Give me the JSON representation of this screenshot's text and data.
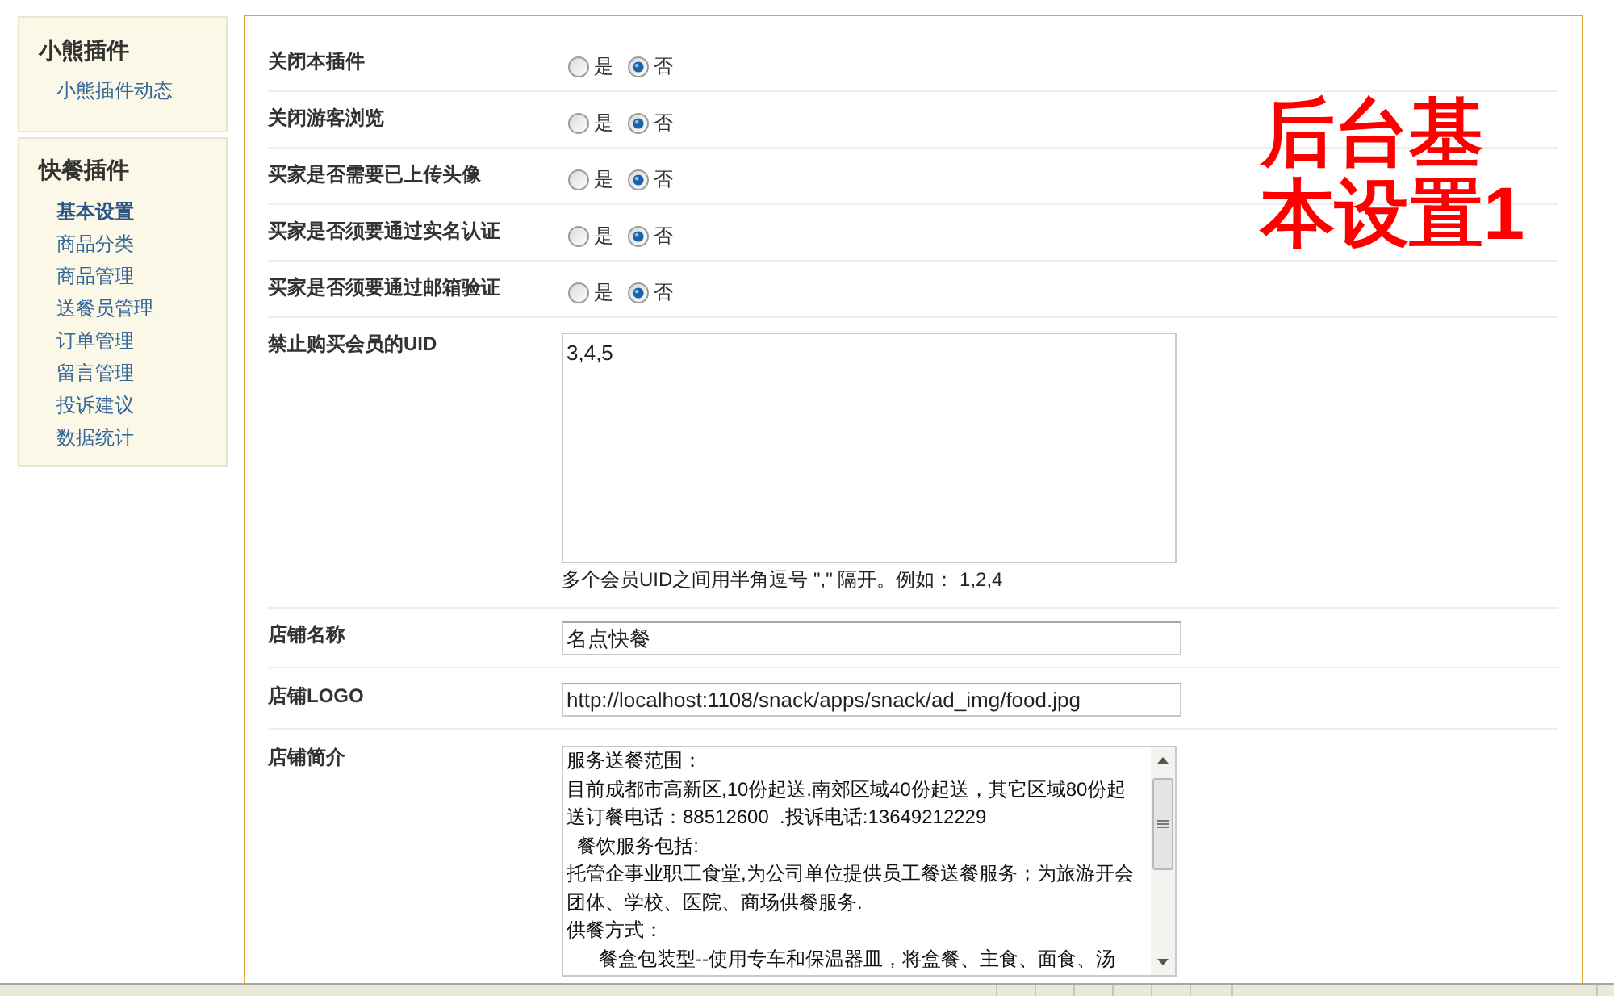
{
  "sidebar": {
    "groups": [
      {
        "title": "小熊插件",
        "items": [
          {
            "label": "小熊插件动态",
            "selected": false
          }
        ]
      },
      {
        "title": "快餐插件",
        "items": [
          {
            "label": "基本设置",
            "selected": true
          },
          {
            "label": "商品分类",
            "selected": false
          },
          {
            "label": "商品管理",
            "selected": false
          },
          {
            "label": "送餐员管理",
            "selected": false
          },
          {
            "label": "订单管理",
            "selected": false
          },
          {
            "label": "留言管理",
            "selected": false
          },
          {
            "label": "投诉建议",
            "selected": false
          },
          {
            "label": "数据统计",
            "selected": false
          }
        ]
      }
    ]
  },
  "form": {
    "rows": [
      {
        "kind": "radio",
        "label": "关闭本插件",
        "options": [
          {
            "label": "是",
            "selected": false
          },
          {
            "label": "否",
            "selected": true
          }
        ]
      },
      {
        "kind": "radio",
        "label": "关闭游客浏览",
        "options": [
          {
            "label": "是",
            "selected": false
          },
          {
            "label": "否",
            "selected": true
          }
        ]
      },
      {
        "kind": "radio",
        "label": "买家是否需要已上传头像",
        "options": [
          {
            "label": "是",
            "selected": false
          },
          {
            "label": "否",
            "selected": true
          }
        ]
      },
      {
        "kind": "radio",
        "label": "买家是否须要通过实名认证",
        "options": [
          {
            "label": "是",
            "selected": false
          },
          {
            "label": "否",
            "selected": true
          }
        ]
      },
      {
        "kind": "radio",
        "label": "买家是否须要通过邮箱验证",
        "options": [
          {
            "label": "是",
            "selected": false
          },
          {
            "label": "否",
            "selected": true
          }
        ]
      },
      {
        "kind": "textarea",
        "label": "禁止购买会员的UID",
        "value": "3,4,5",
        "hint": "多个会员UID之间用半角逗号 \",\" 隔开。例如： 1,2,4"
      },
      {
        "kind": "input",
        "label": "店铺名称",
        "value": "名点快餐"
      },
      {
        "kind": "input",
        "label": "店铺LOGO",
        "value": "http://localhost:1108/snack/apps/snack/ad_img/food.jpg"
      },
      {
        "kind": "scroll_textarea",
        "label": "店铺简介",
        "lines": [
          "服务送餐范围：",
          "目前成都市高新区,10份起送.南郊区域40份起送，其它区域80份起",
          "送订餐电话：88512600  .投诉电话:13649212229",
          "  餐饮服务包括:",
          "托管企事业职工食堂,为公司单位提供员工餐送餐服务；为旅游开会",
          "团体、学校、医院、商场供餐服务.",
          "供餐方式：",
          "      餐盒包装型--使用专车和保温器皿，将盒餐、主食、面食、汤"
        ]
      }
    ]
  },
  "annotation": {
    "lines": [
      "后台基",
      "本设置1"
    ]
  }
}
